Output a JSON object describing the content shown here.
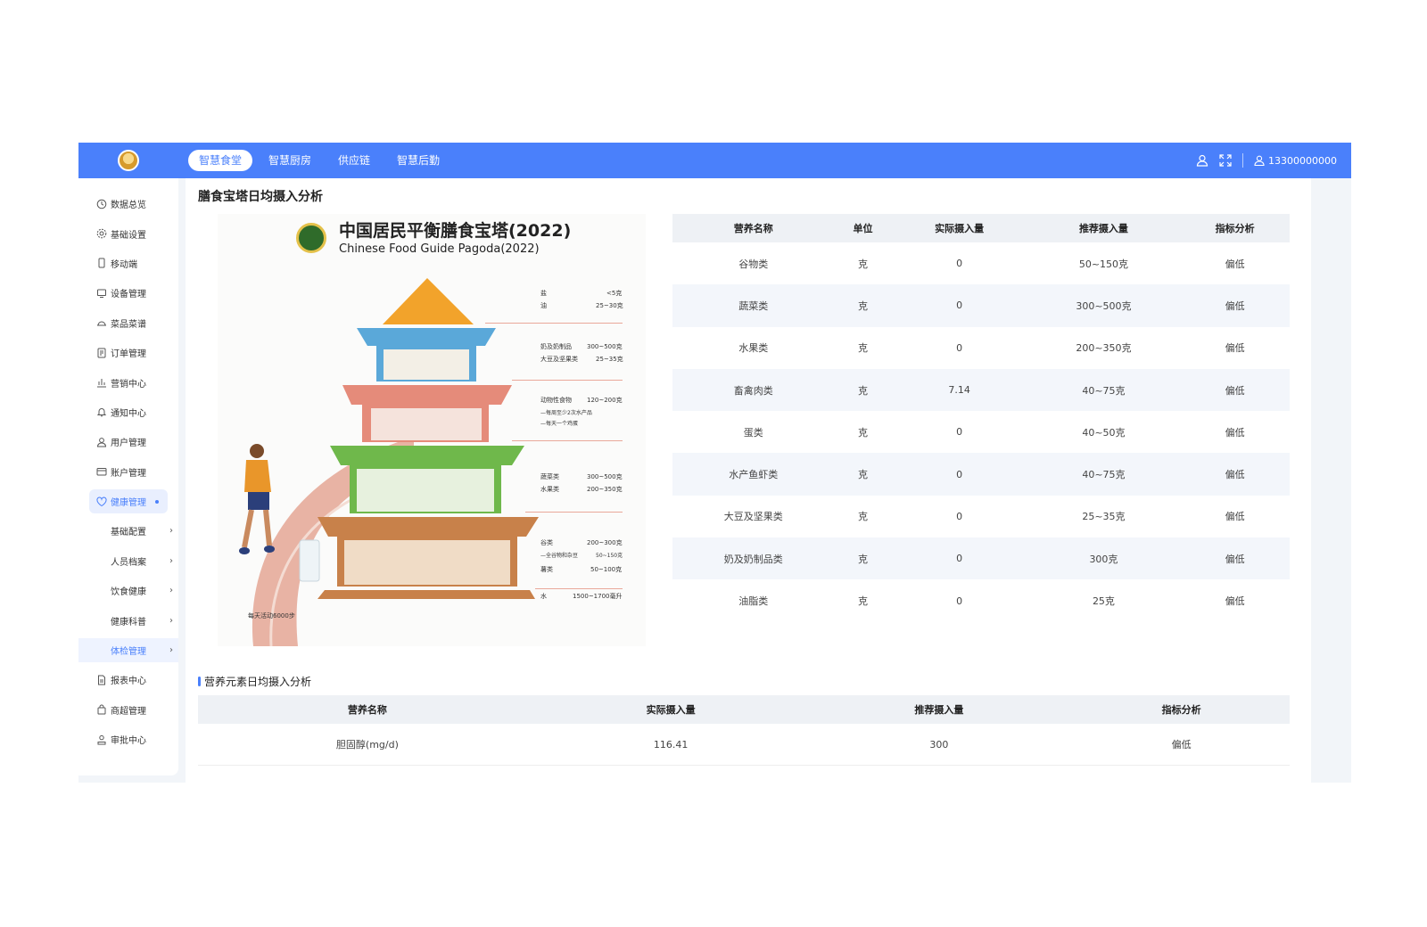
{
  "topnav": {
    "tabs": [
      {
        "label": "智慧食堂"
      },
      {
        "label": "智慧厨房"
      },
      {
        "label": "供应链"
      },
      {
        "label": "智慧后勤"
      }
    ],
    "user_phone": "13300000000"
  },
  "sidebar": {
    "items": [
      {
        "label": "数据总览",
        "icon": "clock-icon"
      },
      {
        "label": "基础设置",
        "icon": "settings-icon"
      },
      {
        "label": "移动端",
        "icon": "mobile-icon"
      },
      {
        "label": "设备管理",
        "icon": "monitor-icon"
      },
      {
        "label": "菜品菜谱",
        "icon": "dish-icon"
      },
      {
        "label": "订单管理",
        "icon": "order-icon"
      },
      {
        "label": "营销中心",
        "icon": "chart-icon"
      },
      {
        "label": "通知中心",
        "icon": "bell-icon"
      },
      {
        "label": "用户管理",
        "icon": "user-icon"
      },
      {
        "label": "账户管理",
        "icon": "wallet-icon"
      },
      {
        "label": "健康管理",
        "icon": "heart-icon"
      }
    ],
    "health_sub": [
      {
        "label": "基础配置"
      },
      {
        "label": "人员档案"
      },
      {
        "label": "饮食健康"
      },
      {
        "label": "健康科普"
      },
      {
        "label": "体检管理"
      }
    ],
    "tail_items": [
      {
        "label": "报表中心",
        "icon": "report-icon"
      },
      {
        "label": "商超管理",
        "icon": "shop-icon"
      },
      {
        "label": "审批中心",
        "icon": "approve-icon"
      }
    ]
  },
  "main": {
    "section_title": "膳食宝塔日均摄入分析",
    "pagoda": {
      "title": "中国居民平衡膳食宝塔(2022)",
      "subtitle": "Chinese Food Guide Pagoda(2022)",
      "labels": {
        "salt": "盐",
        "salt_val": "<5克",
        "oil": "油",
        "oil_val": "25~30克",
        "dairy": "奶及奶制品",
        "dairy_val": "300~500克",
        "soy": "大豆及坚果类",
        "soy_val": "25~35克",
        "animal": "动物性食物",
        "animal_val": "120~200克",
        "animal_note1": "—每周至少2次水产品",
        "animal_note2": "—每天一个鸡蛋",
        "veg": "蔬菜类",
        "veg_val": "300~500克",
        "fruit": "水果类",
        "fruit_val": "200~350克",
        "grain": "谷类",
        "grain_val": "200~300克",
        "grain_note": "—全谷物和杂豆",
        "grain_note_val": "50~150克",
        "tuber": "薯类",
        "tuber_val": "50~100克",
        "water": "水",
        "water_val": "1500~1700毫升",
        "activity": "每天活动6000步"
      }
    },
    "table1": {
      "headers": [
        "营养名称",
        "单位",
        "实际摄入量",
        "推荐摄入量",
        "指标分析"
      ],
      "rows": [
        [
          "谷物类",
          "克",
          "0",
          "50~150克",
          "偏低"
        ],
        [
          "蔬菜类",
          "克",
          "0",
          "300~500克",
          "偏低"
        ],
        [
          "水果类",
          "克",
          "0",
          "200~350克",
          "偏低"
        ],
        [
          "畜禽肉类",
          "克",
          "7.14",
          "40~75克",
          "偏低"
        ],
        [
          "蛋类",
          "克",
          "0",
          "40~50克",
          "偏低"
        ],
        [
          "水产鱼虾类",
          "克",
          "0",
          "40~75克",
          "偏低"
        ],
        [
          "大豆及坚果类",
          "克",
          "0",
          "25~35克",
          "偏低"
        ],
        [
          "奶及奶制品类",
          "克",
          "0",
          "300克",
          "偏低"
        ],
        [
          "油脂类",
          "克",
          "0",
          "25克",
          "偏低"
        ]
      ]
    },
    "section2_title": "营养元素日均摄入分析",
    "table2": {
      "headers": [
        "营养名称",
        "实际摄入量",
        "推荐摄入量",
        "指标分析"
      ],
      "rows": [
        [
          "胆固醇(mg/d)",
          "116.41",
          "300",
          "偏低"
        ]
      ]
    }
  },
  "colors": {
    "primary": "#4a80fb",
    "alert": "#ee3d4f"
  }
}
